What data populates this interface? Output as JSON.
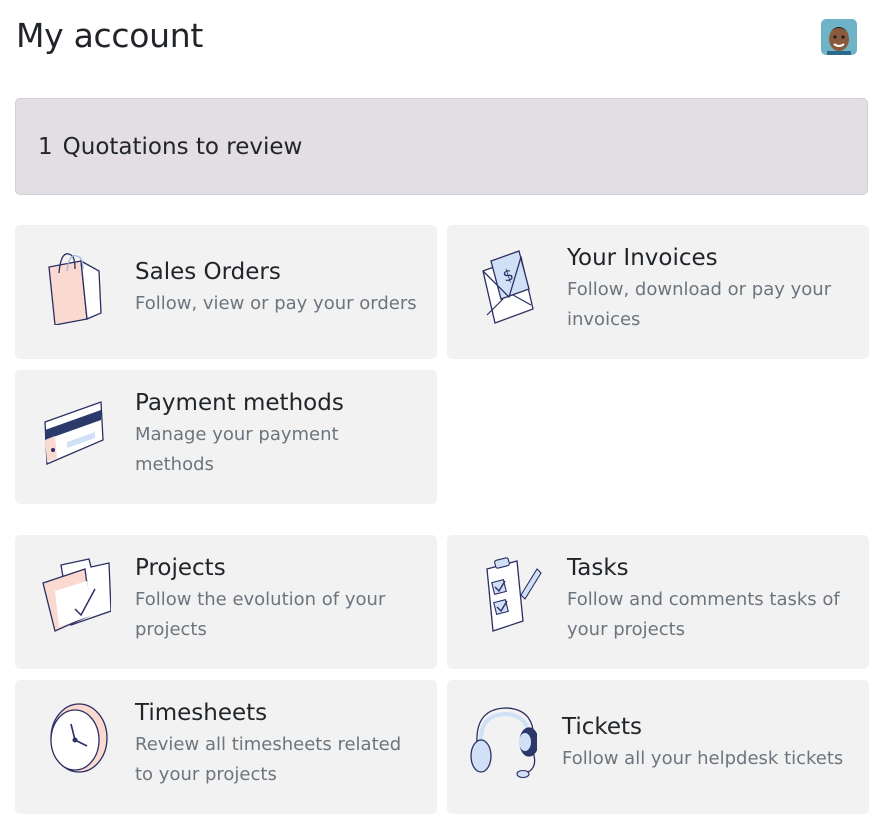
{
  "page": {
    "title": "My account"
  },
  "alert": {
    "count": "1",
    "label": "Quotations to review"
  },
  "cards": [
    {
      "title": "Sales Orders",
      "description": "Follow, view or pay your orders",
      "icon": "shopping-bag-icon"
    },
    {
      "title": "Your Invoices",
      "description": "Follow, download or pay your invoices",
      "icon": "invoice-envelope-icon"
    },
    {
      "title": "Payment methods",
      "description": "Manage your payment methods",
      "icon": "credit-card-icon"
    },
    {
      "title": "Projects",
      "description": "Follow the evolution of your projects",
      "icon": "folder-check-icon"
    },
    {
      "title": "Tasks",
      "description": "Follow and comments tasks of your projects",
      "icon": "clipboard-checklist-icon"
    },
    {
      "title": "Timesheets",
      "description": "Review all timesheets related to your projects",
      "icon": "clock-icon"
    },
    {
      "title": "Tickets",
      "description": "Follow all your helpdesk tickets",
      "icon": "headset-icon"
    }
  ],
  "colors": {
    "alert_bg": "#e2dee3",
    "card_bg": "#f2f2f2",
    "icon_outline": "#2b2f63",
    "icon_pink": "#f9d9d0",
    "icon_blue": "#cfe0f7"
  }
}
